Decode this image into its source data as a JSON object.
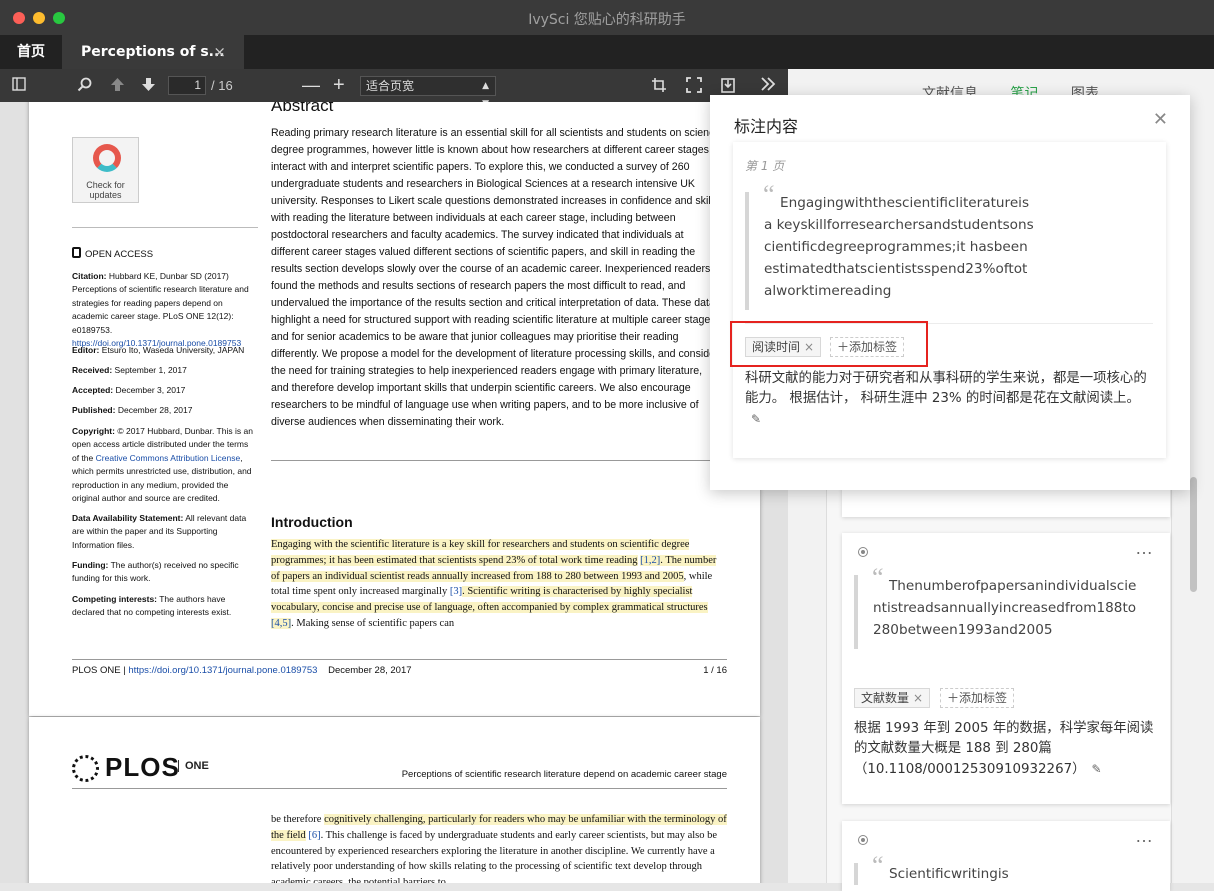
{
  "window": {
    "title": "IvySci 您贴心的科研助手"
  },
  "tabs": {
    "home": "首页",
    "doc": "Perceptions of s...",
    "close_glyph": "×"
  },
  "toolbar": {
    "page_current": "1",
    "page_total": "/ 16",
    "zoom_value": "适合页宽",
    "zoom_minus": "—",
    "zoom_plus": "+"
  },
  "pdf": {
    "abstract_heading": "Abstract",
    "abstract_text": "Reading primary research literature is an essential skill for all scientists and students on science degree programmes, however little is known about how researchers at different career stages interact with and interpret scientific papers. To explore this, we conducted a survey of 260 undergraduate students and researchers in Biological Sciences at a research intensive UK university. Responses to Likert scale questions demonstrated increases in confidence and skill with reading the literature between individuals at each career stage, including between postdoctoral researchers and faculty academics. The survey indicated that individuals at different career stages valued different sections of scientific papers, and skill in reading the results section develops slowly over the course of an academic career. Inexperienced readers found the methods and results sections of research papers the most difficult to read, and undervalued the importance of the results section and critical interpretation of data. These data highlight a need for structured support with reading scientific literature at multiple career stages, and for senior academics to be aware that junior colleagues may prioritise their reading differently. We propose a model for the development of literature processing skills, and consider the need for training strategies to help inexperienced readers engage with primary literature, and therefore develop important skills that underpin scientific careers. We also encourage researchers to be mindful of language use when writing papers, and to be more inclusive of diverse audiences when disseminating their work.",
    "badge_text": "Check for updates",
    "open_access": "OPEN ACCESS",
    "citation_label": "Citation:",
    "citation_text": "Hubbard KE, Dunbar SD (2017) Perceptions of scientific research literature and strategies for reading papers depend on academic career stage. PLoS ONE 12(12): e0189753.",
    "citation_link": "https://doi.org/10.1371/journal.pone.0189753",
    "editor_label": "Editor:",
    "editor_text": "Etsuro Ito, Waseda University, JAPAN",
    "received_label": "Received:",
    "received_text": "September 1, 2017",
    "accepted_label": "Accepted:",
    "accepted_text": "December 3, 2017",
    "published_label": "Published:",
    "published_text": "December 28, 2017",
    "copyright_label": "Copyright:",
    "copyright_text_a": "© 2017 Hubbard, Dunbar. This is an open access article distributed under the terms of the",
    "copyright_link": "Creative Commons Attribution License",
    "copyright_text_b": ", which permits unrestricted use, distribution, and reproduction in any medium, provided the original author and source are credited.",
    "data_label": "Data Availability Statement:",
    "data_text": "All relevant data are within the paper and its Supporting Information files.",
    "funding_label": "Funding:",
    "funding_text": "The author(s) received no specific funding for this work.",
    "competing_label": "Competing interests:",
    "competing_text": "The authors have declared that no competing interests exist.",
    "intro_heading": "Introduction",
    "intro_hl1": "Engaging with the scientific literature is a key skill for researchers and students on scientific degree programmes; it has been estimated that scientists spend 23% of total work time reading",
    "intro_ref1": "[1,2]",
    "intro_hl2": ". The number of papers an individual scientist reads annually increased from 188 to 280 between 1993 and 2005",
    "intro_plain1": ", while total time spent only increased marginally ",
    "intro_ref2": "[3]",
    "intro_hl3": ". Scientific writing is characterised by highly specialist vocabulary, concise and precise use of language, often accompanied by complex grammatical structures",
    "intro_ref3": "[4,5]",
    "intro_plain2": ". Making sense of scientific papers can",
    "footer_journal": "PLOS ONE |",
    "footer_link": "https://doi.org/10.1371/journal.pone.0189753",
    "footer_date": "December 28, 2017",
    "footer_page": "1 / 16",
    "p2_logo": "PLOS",
    "p2_one": "ONE",
    "p2_running": "Perceptions of scientific research literature depend on academic career stage",
    "p2_plain1": "be therefore ",
    "p2_hl1": "cognitively challenging, particularly for readers who may be unfamiliar with the terminology of the field",
    "p2_ref1": "[6]",
    "p2_plain2": ". This challenge is faced by undergraduate students and early career scientists, but may also be encountered by experienced researchers exploring the literature in another discipline. We currently have a relatively poor understanding of how skills relating to the processing of scientific text develop through academic careers, the potential barriers to"
  },
  "right_panel": {
    "tabs": [
      "文献信息",
      "笔记",
      "图表"
    ],
    "cards": [
      {
        "quote": "Thenumberofpapersanindividualscientistreadsannuallyincreasedfrom188to280between1993and2005",
        "tag": "文献数量",
        "add_tag": "添加标签",
        "note": "根据 1993 年到 2005 年的数据，科学家每年阅读的文献数量大概是 188 到 280篇 （10.1108/00012530910932267）"
      },
      {
        "quote": "Scientificwritingis"
      }
    ]
  },
  "popup": {
    "title": "标注内容",
    "page_label": "第 1 页",
    "quote": "Engagingwiththescientificliteratureis a keyskillforresearchersandstudentsonscientificdegreeprogrammes;it hasbeenestimatedthatscientistsspend23%oftotalworktimereading",
    "tag": "阅读时间",
    "add_tag": "添加标签",
    "note": "科研文献的能力对于研究者和从事科研的学生来说，都是一项核心的能力。 根据估计， 科研生涯中 23% 的时间都是花在文献阅读上。"
  },
  "colors": {
    "accent_green": "#2aa24a",
    "highlight": "#faf3c4",
    "annotation_box": "#e5231f",
    "link": "#1a4ea8"
  },
  "icons": [
    "sidebar-toggle-icon",
    "search-icon",
    "arrow-up-icon",
    "arrow-down-icon",
    "crop-icon",
    "fullscreen-icon",
    "download-icon",
    "more-tools-icon",
    "lock-icon",
    "target-icon",
    "ellipsis-icon",
    "close-icon",
    "pencil-icon",
    "plus-icon"
  ]
}
